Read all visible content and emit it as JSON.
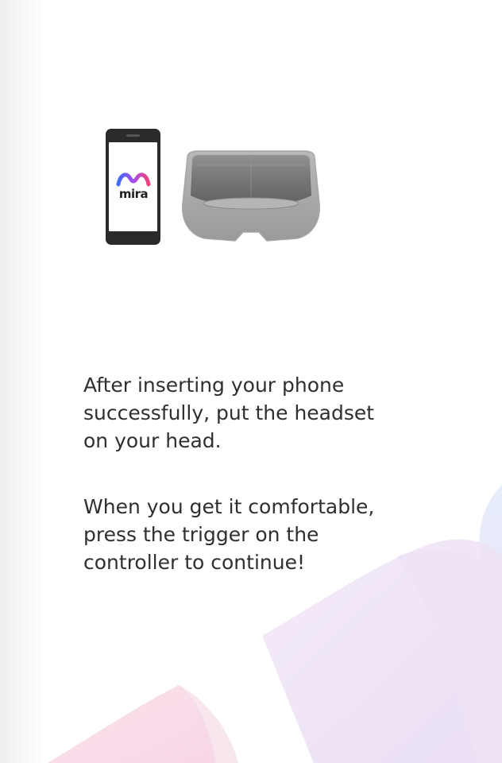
{
  "brand": {
    "name": "mira",
    "gradient": [
      "#3f6df6",
      "#a64cf0",
      "#f0427a"
    ]
  },
  "icons": {
    "phone": "smartphone-icon",
    "headset": "ar-headset-icon",
    "logo": "mira-logo-icon"
  },
  "instructions": {
    "paragraph1": "After inserting your phone\nsuccessfully, put the headset\non your head.",
    "paragraph2": "When you get it comfortable,\npress the trigger on the\ncontroller to continue!"
  },
  "colors": {
    "text": "#2f2f2f",
    "phone_body": "#2b2b2b",
    "background_accent_pink": "#f5c8d8",
    "background_accent_purple": "#e7dcf3",
    "background_accent_blue": "#dfe8f8"
  }
}
